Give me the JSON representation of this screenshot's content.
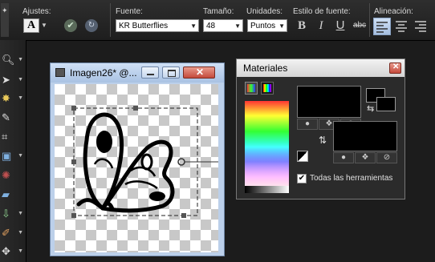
{
  "toolbar": {
    "presets_label": "Ajustes:",
    "font_label": "Fuente:",
    "font_value": "KR Butterflies",
    "size_label": "Tamaño:",
    "size_value": "48",
    "units_label": "Unidades:",
    "units_value": "Puntos",
    "style_label": "Estilo de fuente:",
    "bold": "B",
    "italic": "I",
    "underline": "U",
    "strike": "abc",
    "align_label": "Alineación:"
  },
  "image_window": {
    "title": "Imagen26* @..."
  },
  "materials": {
    "title": "Materiales",
    "all_tools_label": "Todas las herramientas",
    "all_tools_checked": true,
    "foreground_color": "#000000",
    "background_color": "#000000"
  },
  "colors": {
    "ui_dark": "#1c1c1c",
    "titlebar_blue": "#bcd0ea",
    "close_red": "#c44a3c"
  }
}
